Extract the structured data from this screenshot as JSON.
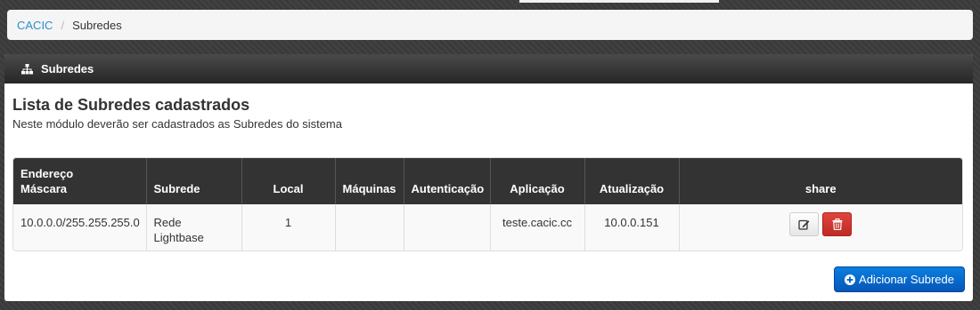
{
  "breadcrumb": {
    "home": "CACIC",
    "separator": "/",
    "current": "Subredes"
  },
  "panel": {
    "header": "Subredes",
    "title": "Lista de Subredes cadastrados",
    "subtitle": "Neste módulo deverão ser cadastrados as Subredes do sistema",
    "header_icon": "sitemap-icon"
  },
  "table": {
    "columns": {
      "endereco_line1": "Endereço",
      "endereco_line2": "Máscara",
      "subrede": "Subrede",
      "local": "Local",
      "maquinas": "Máquinas",
      "autenticacao": "Autenticação",
      "aplicacao": "Aplicação",
      "atualizacao": "Atualização",
      "share": "share"
    },
    "rows": [
      {
        "endereco": "10.0.0.0/255.255.255.0",
        "subrede_line1": "Rede",
        "subrede_line2": "Lightbase",
        "local": "1",
        "maquinas": "",
        "autenticacao": "",
        "aplicacao": "teste.cacic.cc",
        "atualizacao": "10.0.0.151"
      }
    ]
  },
  "actions": {
    "add_label": "Adicionar Subrede"
  },
  "colors": {
    "link": "#2a8fc7",
    "primary": "#0a6fd1",
    "danger": "#d9534f",
    "header_bg": "#333333"
  }
}
